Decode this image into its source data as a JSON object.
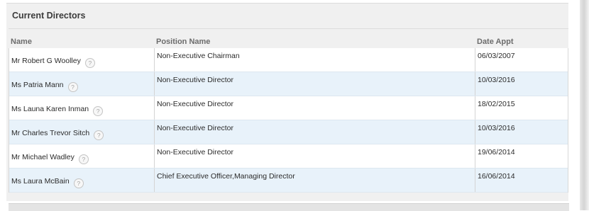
{
  "panel": {
    "title": "Current Directors"
  },
  "table": {
    "headers": {
      "name": "Name",
      "position": "Position Name",
      "date": "Date Appt"
    },
    "rows": [
      {
        "name": "Mr Robert G Woolley",
        "position": "Non-Executive Chairman",
        "date": "06/03/2007"
      },
      {
        "name": "Ms Patria Mann",
        "position": "Non-Executive Director",
        "date": "10/03/2016"
      },
      {
        "name": "Ms Launa Karen Inman",
        "position": "Non-Executive Director",
        "date": "18/02/2015"
      },
      {
        "name": "Mr Charles Trevor Sitch",
        "position": "Non-Executive Director",
        "date": "10/03/2016"
      },
      {
        "name": "Mr Michael Wadley",
        "position": "Non-Executive Director",
        "date": "19/06/2014"
      },
      {
        "name": "Ms Laura McBain",
        "position": "Chief Executive Officer,Managing Director",
        "date": "16/06/2014"
      }
    ]
  },
  "help_icon": {
    "glyph": "?",
    "icon": "help-icon"
  }
}
